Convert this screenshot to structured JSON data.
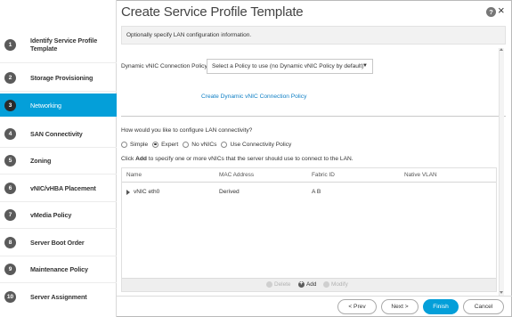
{
  "window": {
    "title": "Create Service Profile Template",
    "help_label": "?",
    "close_label": "×",
    "subtitle": "Optionally specify LAN configuration information."
  },
  "sidebar": {
    "items": [
      {
        "num": "1",
        "label": "Identify Service Profile Template"
      },
      {
        "num": "2",
        "label": "Storage Provisioning"
      },
      {
        "num": "3",
        "label": "Networking"
      },
      {
        "num": "4",
        "label": "SAN Connectivity"
      },
      {
        "num": "5",
        "label": "Zoning"
      },
      {
        "num": "6",
        "label": "vNIC/vHBA Placement"
      },
      {
        "num": "7",
        "label": "vMedia Policy"
      },
      {
        "num": "8",
        "label": "Server Boot Order"
      },
      {
        "num": "9",
        "label": "Maintenance Policy"
      },
      {
        "num": "10",
        "label": "Server Assignment"
      }
    ],
    "active_index": 2
  },
  "policy": {
    "label": "Dynamic vNIC Connection Policy:",
    "selected": "Select a Policy to use (no Dynamic vNIC Policy by default)",
    "caret": "▼",
    "create_link": "Create Dynamic vNIC Connection Policy"
  },
  "lan": {
    "question": "How would you like to configure LAN connectivity?",
    "options": [
      {
        "label": "Simple",
        "selected": false
      },
      {
        "label": "Expert",
        "selected": true
      },
      {
        "label": "No vNICs",
        "selected": false
      },
      {
        "label": "Use Connectivity Policy",
        "selected": false
      }
    ],
    "info_prefix": "Click ",
    "info_bold": "Add",
    "info_suffix": " to specify one or more vNICs that the server should use to connect to the LAN."
  },
  "table": {
    "headers": {
      "name": "Name",
      "mac": "MAC Address",
      "fabric": "Fabric ID",
      "vlan": "Native VLAN"
    },
    "rows": [
      {
        "name": "vNIC eth0",
        "mac": "Derived",
        "fabric": "A B",
        "vlan": ""
      }
    ],
    "actions": {
      "delete": "Delete",
      "add": "Add",
      "modify": "Modify"
    }
  },
  "footer": {
    "prev": "< Prev",
    "next": "Next >",
    "finish": "Finish",
    "cancel": "Cancel"
  },
  "colors": {
    "accent": "#049fd9",
    "link": "#0d7ec4"
  }
}
